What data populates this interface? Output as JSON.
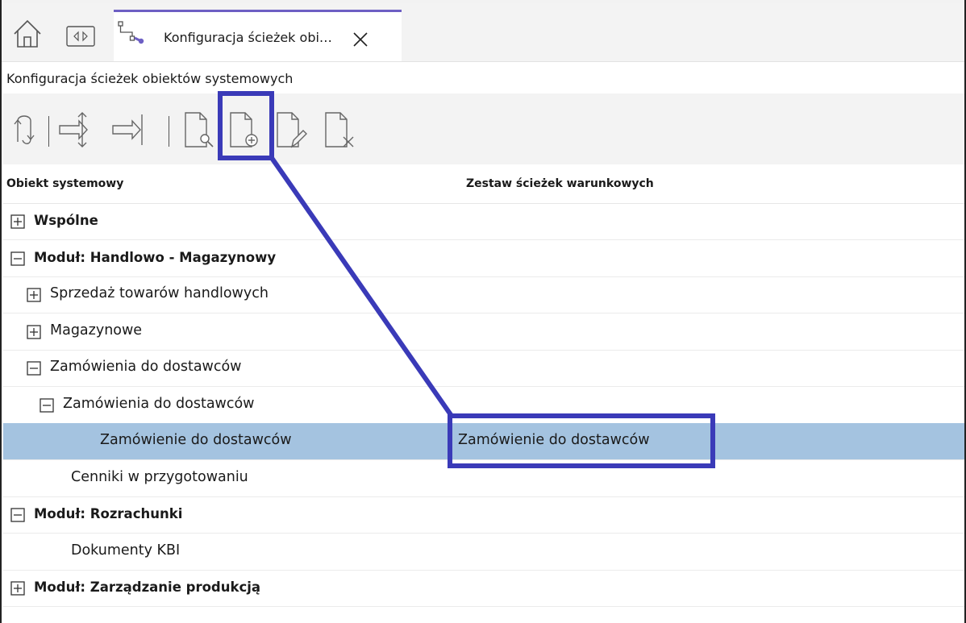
{
  "tab": {
    "label": "Konfiguracja ścieżek obi…"
  },
  "window": {
    "title": "Konfiguracja ścieżek obiektów systemowych"
  },
  "toolbar": {
    "items": [
      {
        "icon": "refresh-icon"
      },
      {
        "icon": "expand-collapse-vertical-icon"
      },
      {
        "icon": "expand-collapse-horizontal-icon"
      },
      {
        "icon": "document-preview-icon"
      },
      {
        "icon": "document-add-icon",
        "highlighted": true
      },
      {
        "icon": "document-edit-icon"
      },
      {
        "icon": "document-delete-icon"
      }
    ]
  },
  "grid": {
    "columns": [
      "Obiekt systemowy",
      "Zestaw ścieżek warunkowych"
    ],
    "rows": [
      {
        "label": "Wspólne",
        "bold": true,
        "expander": "plus",
        "value": ""
      },
      {
        "label": "Moduł: Handlowo - Magazynowy",
        "bold": true,
        "expander": "minus",
        "value": ""
      },
      {
        "label": "Sprzedaż towarów handlowych",
        "bold": false,
        "expander": "plus",
        "value": ""
      },
      {
        "label": "Magazynowe",
        "bold": false,
        "expander": "plus",
        "value": ""
      },
      {
        "label": "Zamówienia do dostawców",
        "bold": false,
        "expander": "minus",
        "value": ""
      },
      {
        "label": "Zamówienia do dostawców",
        "bold": false,
        "expander": "minus",
        "value": ""
      },
      {
        "label": "Zamówienie do dostawców",
        "bold": false,
        "expander": "",
        "value": "Zamówienie do dostawców",
        "selected": true
      },
      {
        "label": "Cenniki w przygotowaniu",
        "bold": false,
        "expander": "",
        "value": ""
      },
      {
        "label": "Moduł: Rozrachunki",
        "bold": true,
        "expander": "minus",
        "value": ""
      },
      {
        "label": "Dokumenty KBI",
        "bold": false,
        "expander": "",
        "value": ""
      },
      {
        "label": "Moduł: Zarządzanie produkcją",
        "bold": true,
        "expander": "plus",
        "value": ""
      }
    ]
  },
  "colors": {
    "accent": "#6d5fc4",
    "selection": "#a4c3e0",
    "annotation": "#3a3ab8"
  }
}
